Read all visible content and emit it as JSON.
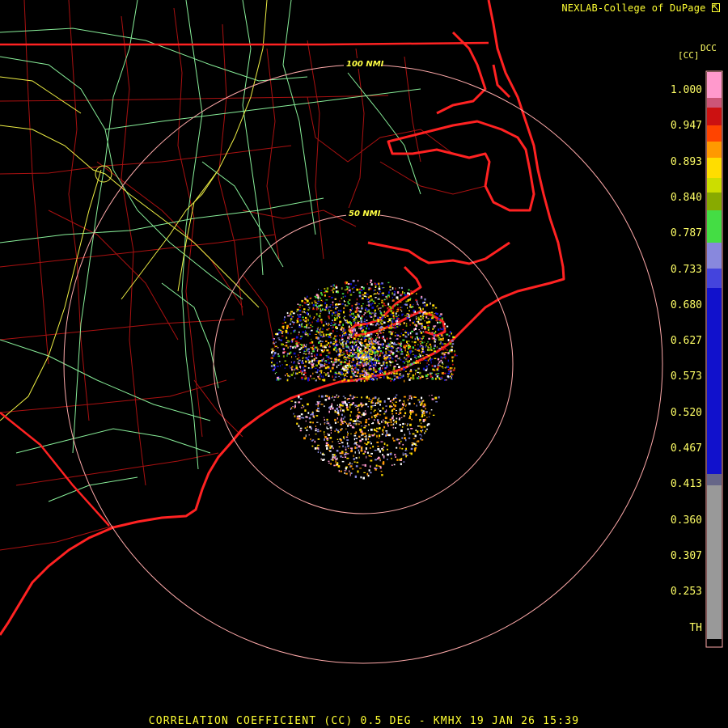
{
  "header": {
    "credit": "NEXLAB-College of DuPage",
    "credit_icon": "arrow-box-icon"
  },
  "legend": {
    "product_code": "DCC",
    "unit": "[CC]",
    "ticks": [
      "1.000",
      "0.947",
      "0.893",
      "0.840",
      "0.787",
      "0.733",
      "0.680",
      "0.627",
      "0.573",
      "0.520",
      "0.467",
      "0.413",
      "0.360",
      "0.307",
      "0.253",
      "TH"
    ],
    "colors": {
      "pink": "#ff99cc",
      "red": "#cc1111",
      "orange": "#ff8800",
      "yellow": "#ffdd00",
      "olive": "#99bb00",
      "green": "#44dd44",
      "lavender": "#8888dd",
      "blue": "#1111cc",
      "gray": "#999999",
      "black": "#000000"
    }
  },
  "map": {
    "ring_labels": [
      "100 NMI",
      "50 NMI"
    ],
    "colors": {
      "state_border": "#ff2222",
      "county_lines": "#bb1111",
      "roads_interstate": "#eeee44",
      "roads_highway": "#88ee99",
      "range_rings": "#ffaaaa",
      "coastline": "#ff2222"
    }
  },
  "footer": {
    "caption": "CORRELATION COEFFICIENT (CC) 0.5 DEG - KMHX 19 JAN 26 15:39"
  }
}
